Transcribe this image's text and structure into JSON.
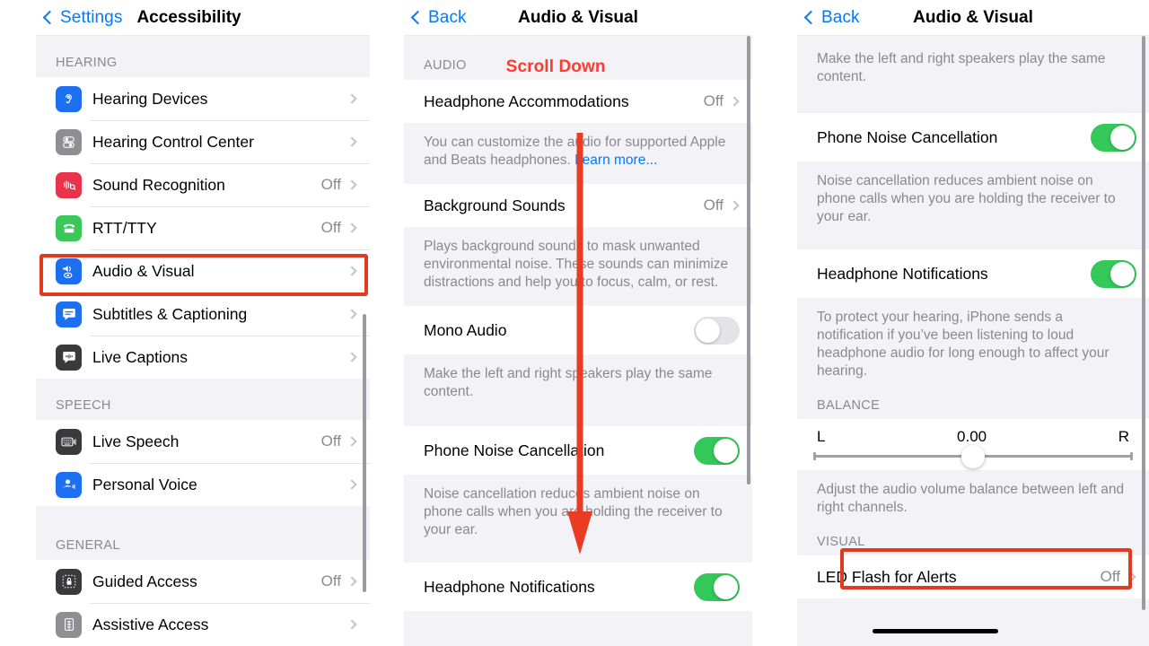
{
  "accent": {
    "blue": "#007aff",
    "green": "#34c759",
    "red": "#ff3b30",
    "annotation": "#e03a20"
  },
  "left_panel": {
    "nav": {
      "back_label": "Settings",
      "title": "Accessibility"
    },
    "sections": [
      {
        "header": "HEARING",
        "rows": [
          {
            "label": "Hearing Devices",
            "value": "",
            "icon": "ear-icon",
            "icon_color": "#1d6ff2",
            "glyph": "P"
          },
          {
            "label": "Hearing Control Center",
            "value": "",
            "icon": "hearing-control-center-icon",
            "icon_color": "#8e8e93",
            "glyph": "≡"
          },
          {
            "label": "Sound Recognition",
            "value": "Off",
            "icon": "sound-recognition-icon",
            "icon_color": "#e8344a",
            "glyph": "‖"
          },
          {
            "label": "RTT/TTY",
            "value": "Off",
            "icon": "rtt-tty-icon",
            "icon_color": "#3cc75a",
            "glyph": "☎"
          },
          {
            "label": "Audio & Visual",
            "value": "",
            "icon": "audio-visual-icon",
            "icon_color": "#1d6ff2",
            "glyph": "◂"
          },
          {
            "label": "Subtitles & Captioning",
            "value": "",
            "icon": "subtitles-icon",
            "icon_color": "#1d6ff2",
            "glyph": "⌸"
          },
          {
            "label": "Live Captions",
            "value": "",
            "icon": "live-captions-icon",
            "icon_color": "#3a3a3c",
            "glyph": "❖"
          }
        ]
      },
      {
        "header": "SPEECH",
        "rows": [
          {
            "label": "Live Speech",
            "value": "Off",
            "icon": "keyboard-icon",
            "icon_color": "#3a3a3c",
            "glyph": "⌨"
          },
          {
            "label": "Personal Voice",
            "value": "",
            "icon": "personal-voice-icon",
            "icon_color": "#1d6ff2",
            "glyph": "☻"
          }
        ]
      },
      {
        "header": "GENERAL",
        "rows": [
          {
            "label": "Guided Access",
            "value": "Off",
            "icon": "lock-icon",
            "icon_color": "#3a3a3c",
            "glyph": "⚿"
          },
          {
            "label": "Assistive Access",
            "value": "",
            "icon": "assistive-access-icon",
            "icon_color": "#8e8e93",
            "glyph": "▦"
          }
        ]
      }
    ],
    "highlight": {
      "target": "Audio & Visual"
    }
  },
  "middle_panel": {
    "nav": {
      "back_label": "Back",
      "title": "Audio & Visual"
    },
    "section_header": "AUDIO",
    "annotation_label": "Scroll Down",
    "rows": [
      {
        "type": "link",
        "label": "Headphone Accommodations",
        "value": "Off"
      },
      {
        "type": "note",
        "text": "You can customize the audio for supported Apple and Beats headphones. ",
        "link_text": "Learn more..."
      },
      {
        "type": "link",
        "label": "Background Sounds",
        "value": "Off"
      },
      {
        "type": "note",
        "text": "Plays background sounds to mask unwanted environmental noise. These sounds can minimize distractions and help you to focus, calm, or rest."
      },
      {
        "type": "toggle",
        "label": "Mono Audio",
        "on": false
      },
      {
        "type": "note",
        "text": "Make the left and right speakers play the same content."
      },
      {
        "type": "toggle",
        "label": "Phone Noise Cancellation",
        "on": true
      },
      {
        "type": "note",
        "text": "Noise cancellation reduces ambient noise on phone calls when you are holding the receiver to your ear."
      },
      {
        "type": "toggle",
        "label": "Headphone Notifications",
        "on": true
      }
    ]
  },
  "right_panel": {
    "nav": {
      "back_label": "Back",
      "title": "Audio & Visual"
    },
    "rows": [
      {
        "type": "note",
        "text": "Make the left and right speakers play the same content."
      },
      {
        "type": "toggle",
        "label": "Phone Noise Cancellation",
        "on": true
      },
      {
        "type": "note",
        "text": "Noise cancellation reduces ambient noise on phone calls when you are holding the receiver to your ear."
      },
      {
        "type": "toggle",
        "label": "Headphone Notifications",
        "on": true
      },
      {
        "type": "note",
        "text": "To protect your hearing, iPhone sends a notification if you’ve been listening to loud headphone audio for long enough to affect your hearing."
      }
    ],
    "balance": {
      "header": "BALANCE",
      "left_label": "L",
      "value": "0.00",
      "right_label": "R",
      "slider_percent": 50,
      "note": "Adjust the audio volume balance between left and right channels."
    },
    "visual": {
      "header": "VISUAL",
      "row": {
        "label": "LED Flash for Alerts",
        "value": "Off"
      }
    },
    "highlight": {
      "target": "LED Flash for Alerts"
    }
  }
}
